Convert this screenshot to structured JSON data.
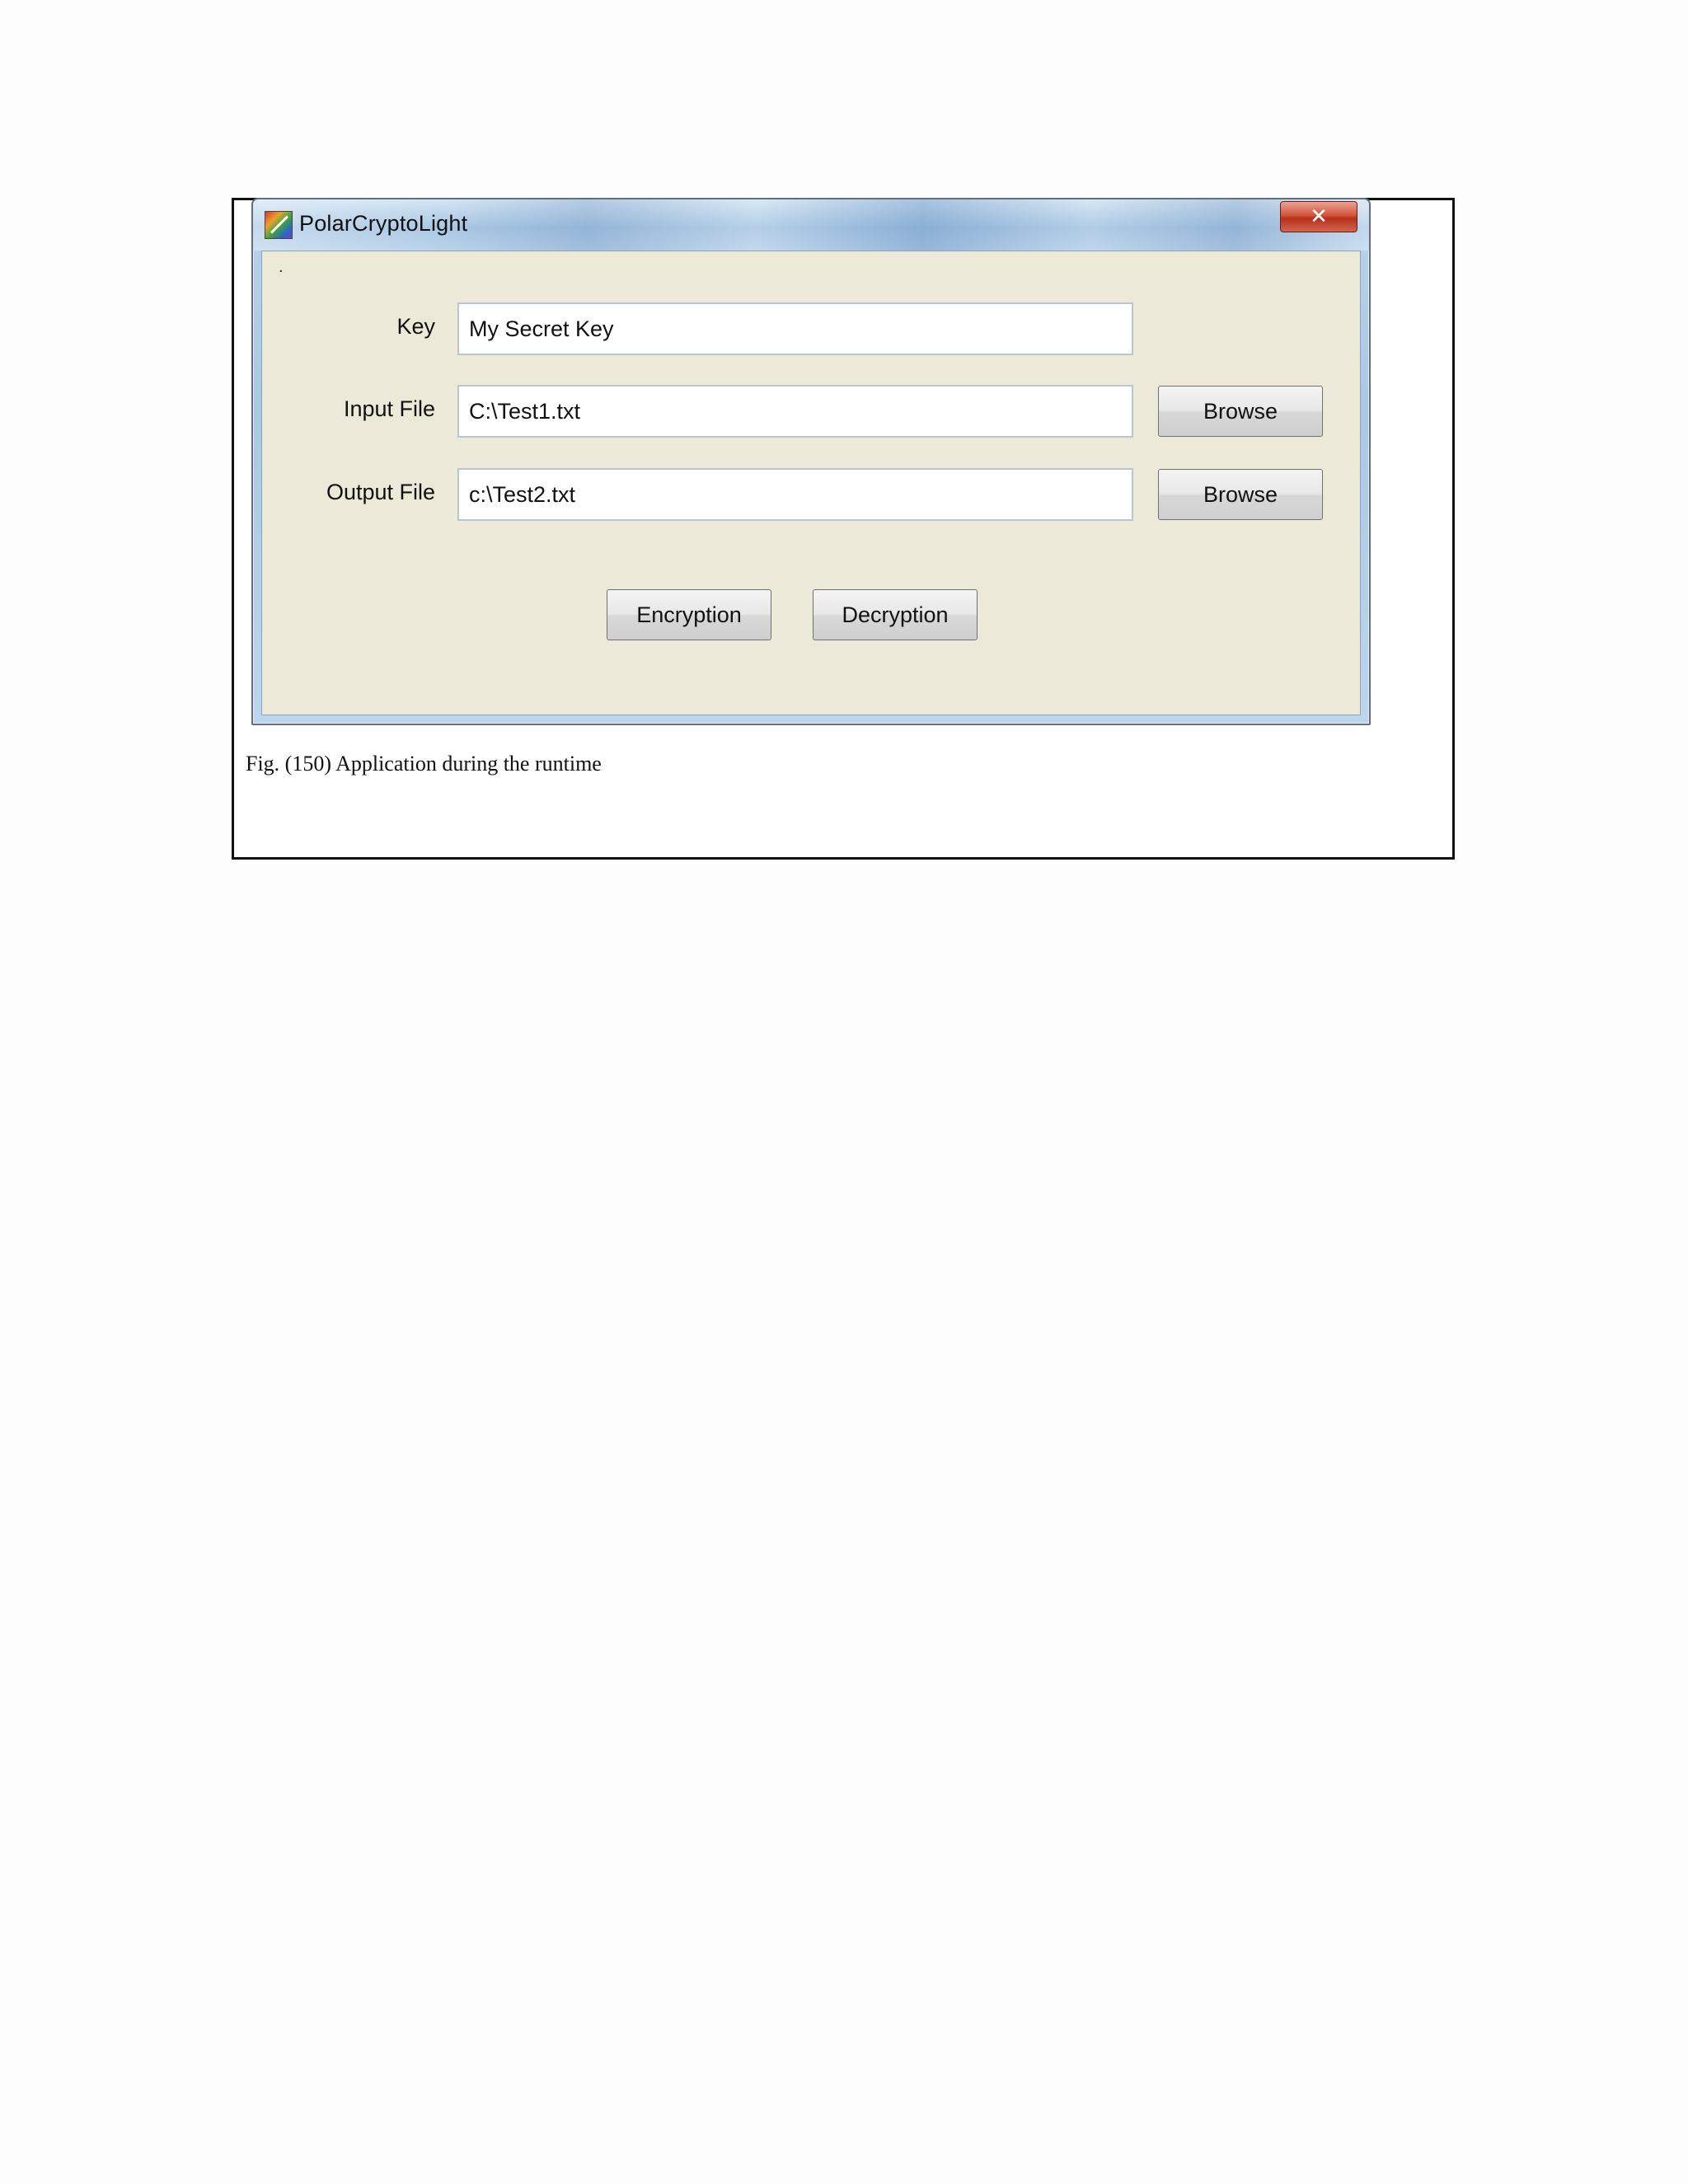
{
  "window": {
    "title": "PolarCryptoLight",
    "close_glyph": "✕",
    "app_icon": "polar-crypto-app-icon"
  },
  "form": {
    "dot": ".",
    "key": {
      "label": "Key",
      "value": "My Secret Key"
    },
    "input_file": {
      "label": "Input File",
      "value": "C:\\Test1.txt",
      "browse_label": "Browse"
    },
    "output_file": {
      "label": "Output File",
      "value": "c:\\Test2.txt",
      "browse_label": "Browse"
    },
    "encryption_label": "Encryption",
    "decryption_label": "Decryption"
  },
  "caption": "Fig. (150) Application during the runtime",
  "colors": {
    "client_background": "#ece9d8",
    "close_button": "#c8452c",
    "window_frame": "#a9c8e4"
  }
}
